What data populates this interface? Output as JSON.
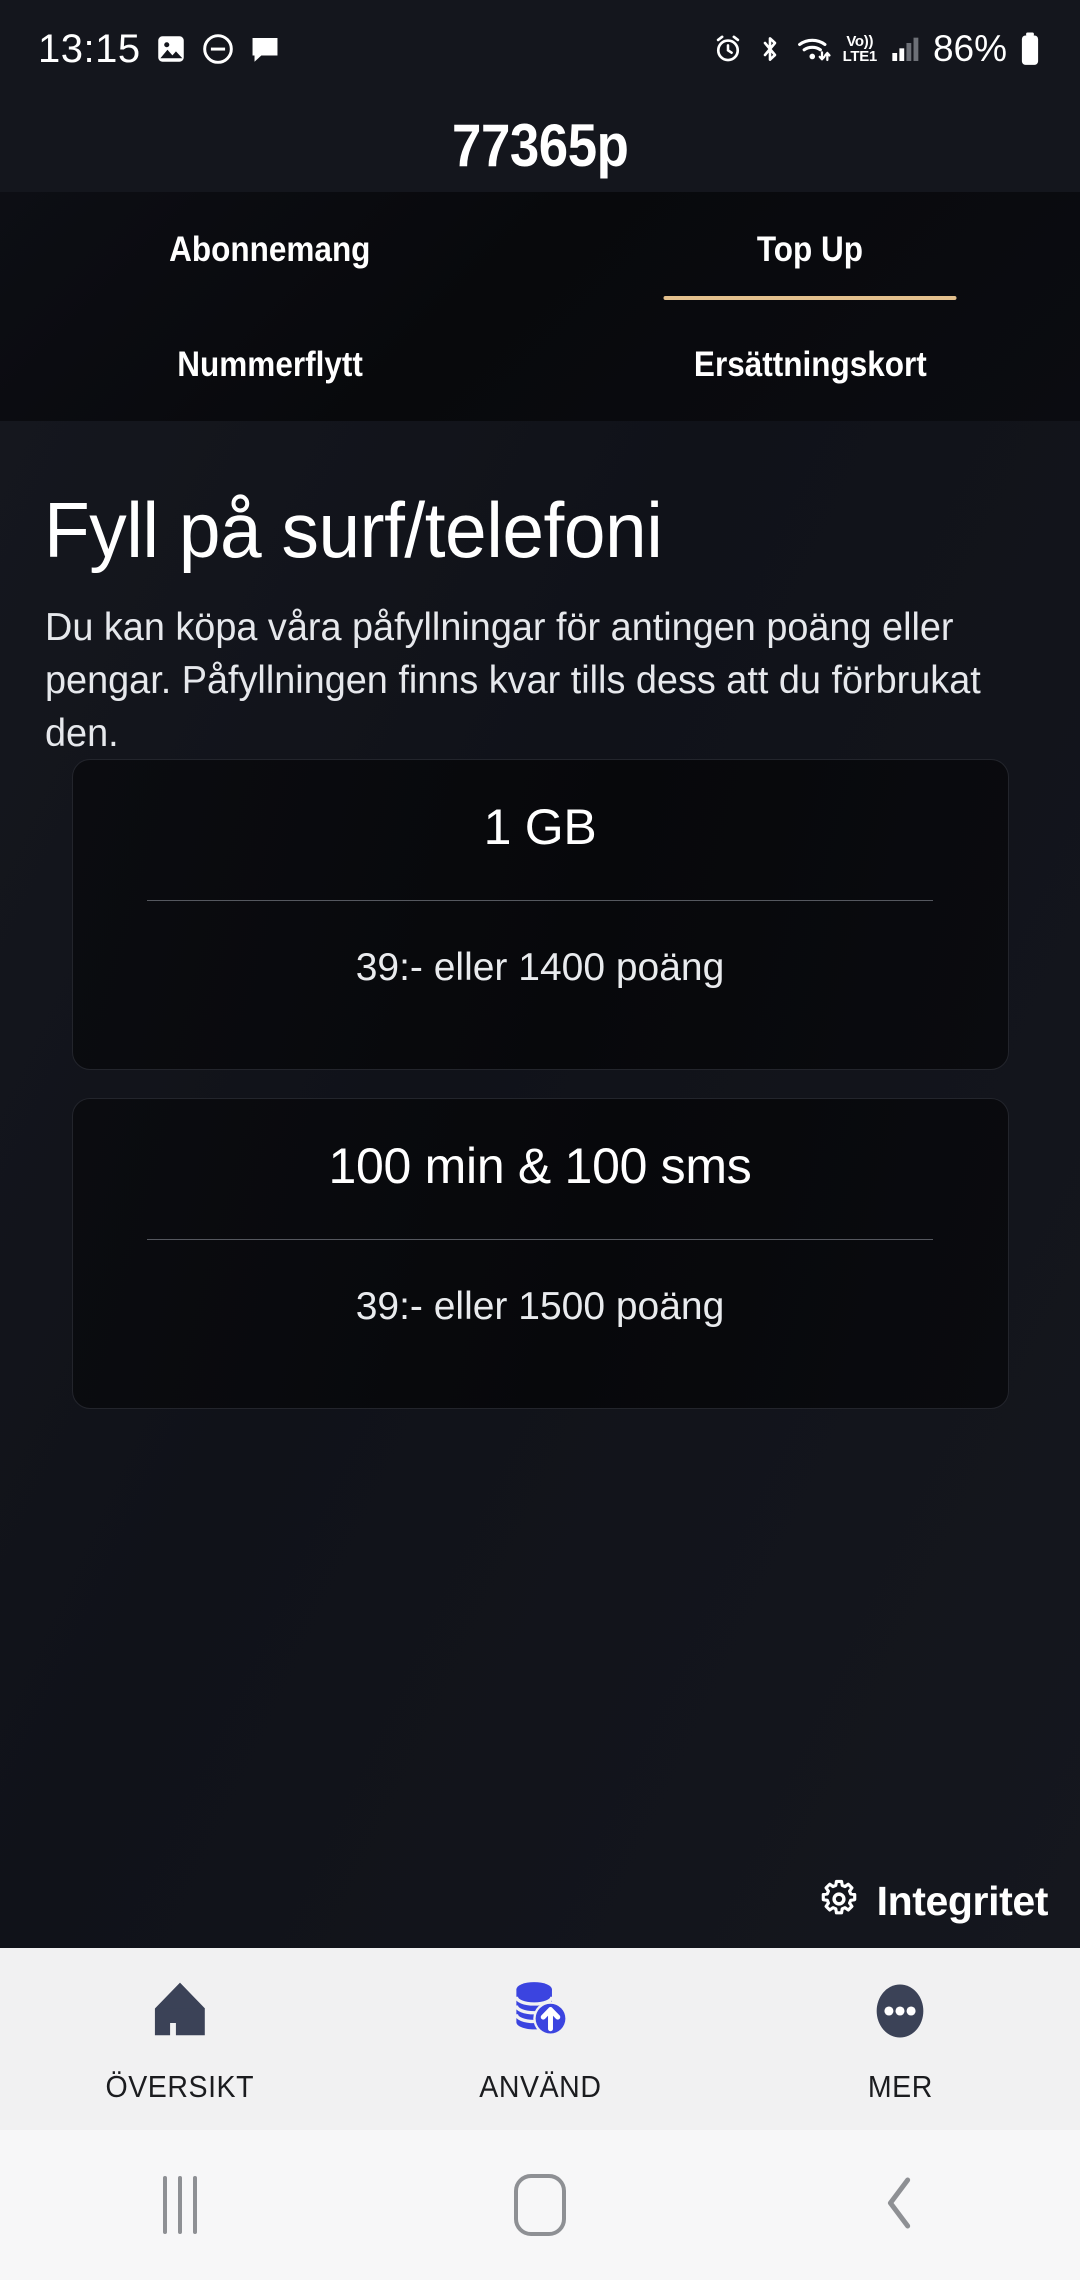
{
  "status_bar": {
    "time": "13:15",
    "battery_percent": "86%",
    "network_label_top": "Vo))",
    "network_label_bottom": "LTE1",
    "left_icons": [
      "image-icon",
      "do-not-disturb-icon",
      "message-bubble-icon"
    ],
    "right_icons": [
      "alarm-icon",
      "bluetooth-icon",
      "wifi-icon",
      "volte-icon",
      "signal-icon",
      "battery-icon"
    ]
  },
  "header": {
    "title": "77365p"
  },
  "tabs": {
    "accent_color": "#e3c08d",
    "row1": [
      {
        "label": "Abonnemang",
        "active": false
      },
      {
        "label": "Top Up",
        "active": true
      }
    ],
    "row2": [
      {
        "label": "Nummerflytt",
        "active": false
      },
      {
        "label": "Ersättningskort",
        "active": false
      }
    ]
  },
  "main": {
    "heading": "Fyll på surf/telefoni",
    "body": "Du kan köpa våra påfyllningar för antingen poäng eller pengar. Påfyllningen finns kvar tills dess att du förbrukat den.",
    "cards": [
      {
        "title": "1 GB",
        "price": "39:- eller 1400 poäng"
      },
      {
        "title": "100 min & 100 sms",
        "price": "39:- eller 1500 poäng"
      }
    ]
  },
  "privacy_widget": {
    "label": "Integritet",
    "icon": "gear-icon"
  },
  "bottom_nav": {
    "items": [
      {
        "label": "ÖVERSIKT",
        "icon": "home-icon",
        "active": false
      },
      {
        "label": "ANVÄND",
        "icon": "coins-up-arrow-icon",
        "active": true
      },
      {
        "label": "MER",
        "icon": "more-dots-icon",
        "active": false
      }
    ],
    "active_color": "#3b44e0",
    "inactive_color": "#3b4257"
  },
  "system_nav": {
    "buttons": [
      "recents-button",
      "home-button",
      "back-button"
    ]
  }
}
